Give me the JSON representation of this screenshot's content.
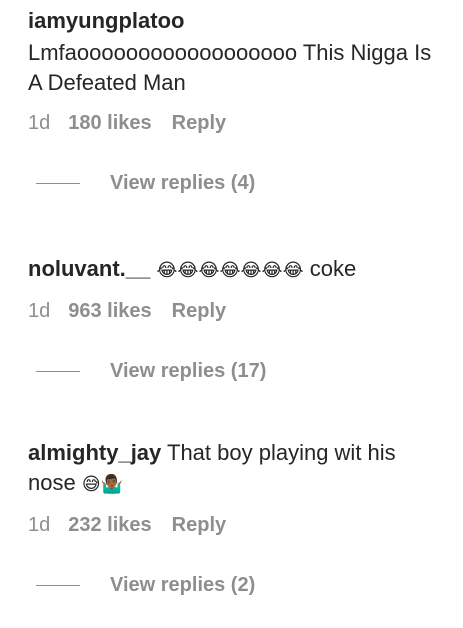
{
  "comments": [
    {
      "username": "iamyungplatoo",
      "text": "Lmfaoooooooooooooooooo This Nigga Is A Defeated Man",
      "emoji": "",
      "time": "1d",
      "likes": "180 likes",
      "reply_label": "Reply",
      "view_replies": "View replies (4)"
    },
    {
      "username": "noluvant.__",
      "text": "",
      "emoji": "😂😂😂😂😂😂😂",
      "text_after": "coke",
      "time": "1d",
      "likes": "963 likes",
      "reply_label": "Reply",
      "view_replies": "View replies (17)"
    },
    {
      "username": "almighty_jay",
      "text": "That boy playing wit his nose",
      "emoji": "😅🤷🏾‍♂️",
      "time": "1d",
      "likes": "232 likes",
      "reply_label": "Reply",
      "view_replies": "View replies (2)"
    }
  ]
}
